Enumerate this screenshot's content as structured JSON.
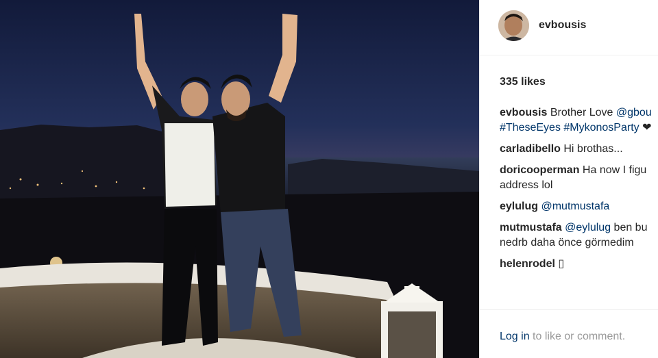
{
  "post": {
    "username": "evbousis",
    "likes": "335 likes",
    "comments": [
      {
        "user": "evbousis",
        "text": "Brother Love ",
        "mention": "@gbou",
        "line2_tags": "#TheseEyes #MykonosParty",
        "line2_extra": " ❤"
      },
      {
        "user": "carladibello",
        "text": "Hi brothas..."
      },
      {
        "user": "doricooperman",
        "text": "Ha now I figu",
        "line2": "address lol"
      },
      {
        "user": "eylulug",
        "mention": "@mutmustafa"
      },
      {
        "user": "mutmustafa",
        "mention": "@eylulug",
        "text": " ben bu",
        "line2": "nedrb daha önce görmedim"
      },
      {
        "user": "helenrodel",
        "text": "▯"
      }
    ],
    "login_link": "Log in",
    "login_rest": " to like or comment."
  },
  "colors": {
    "link": "#003569",
    "text": "#262626",
    "muted": "#999999",
    "divider": "#efefef"
  },
  "icons": {
    "photo": "mykonos-night-photo",
    "avatar": "user-avatar"
  }
}
